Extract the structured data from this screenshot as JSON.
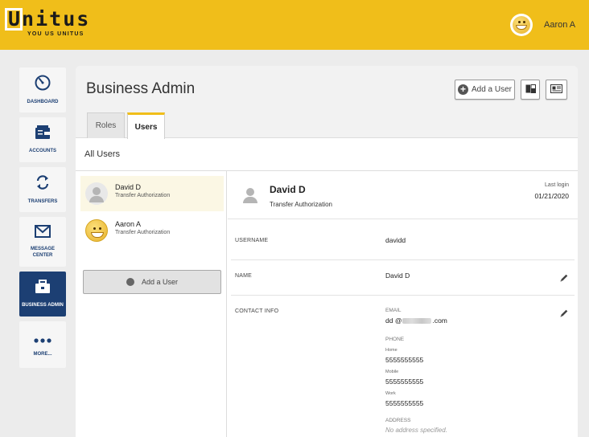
{
  "header": {
    "logo_text": "Unitus",
    "logo_tagline": "YOU US UNITUS",
    "user_name": "Aaron A"
  },
  "sidenav": [
    {
      "label": "DASHBOARD",
      "icon": "dashboard-gauge-icon",
      "active": false
    },
    {
      "label": "ACCOUNTS",
      "icon": "accounts-wallet-icon",
      "active": false
    },
    {
      "label": "TRANSFERS",
      "icon": "transfers-arrows-icon",
      "active": false
    },
    {
      "label": "MESSAGE CENTER",
      "icon": "envelope-icon",
      "active": false
    },
    {
      "label": "BUSINESS ADMIN",
      "icon": "briefcase-icon",
      "active": true
    },
    {
      "label": "MORE...",
      "icon": "more-dots-icon",
      "active": false
    }
  ],
  "main": {
    "title": "Business Admin",
    "add_user_label": "Add a User",
    "tabs": [
      {
        "label": "Roles",
        "active": false
      },
      {
        "label": "Users",
        "active": true
      }
    ],
    "section_label": "All Users"
  },
  "user_list": {
    "items": [
      {
        "name": "David D",
        "role": "Transfer Authorization",
        "selected": true,
        "avatar": "default-person-icon"
      },
      {
        "name": "Aaron A",
        "role": "Transfer Authorization",
        "selected": false,
        "avatar": "smiley-avatar"
      }
    ],
    "add_label": "Add a User"
  },
  "detail": {
    "name": "David D",
    "role": "Transfer Authorization",
    "last_login_label": "Last login",
    "last_login_date": "01/21/2020",
    "fields": {
      "username_label": "USERNAME",
      "username": "davidd",
      "name_label": "NAME",
      "name": "David D",
      "contact_label": "CONTACT INFO",
      "email_label": "EMAIL",
      "email_prefix": "dd @",
      "email_suffix": ".com",
      "phone_label": "PHONE",
      "phones": [
        {
          "type": "Home",
          "number": "5555555555"
        },
        {
          "type": "Mobile",
          "number": "5555555555"
        },
        {
          "type": "Work",
          "number": "5555555555"
        }
      ],
      "address_label": "ADDRESS",
      "address": "No address specified."
    }
  },
  "colors": {
    "brand_yellow": "#f0be1a",
    "nav_blue": "#1c3f73"
  }
}
